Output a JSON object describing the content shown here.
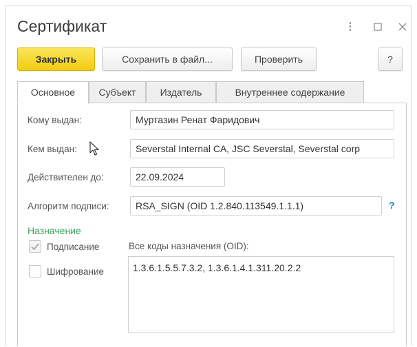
{
  "window": {
    "title": "Сертификат",
    "controls": {
      "more_icon": "⋮",
      "maximize_icon": "☐",
      "close_icon": "✕"
    }
  },
  "toolbar": {
    "close_label": "Закрыть",
    "save_label": "Сохранить в файл...",
    "check_label": "Проверить",
    "help_label": "?"
  },
  "tabs": [
    {
      "label": "Основное",
      "active": true
    },
    {
      "label": "Субъект",
      "active": false
    },
    {
      "label": "Издатель",
      "active": false
    },
    {
      "label": "Внутреннее содержание",
      "active": false
    }
  ],
  "form": {
    "issued_to": {
      "label": "Кому выдан:",
      "value": "Муртазин Ренат Фаридович"
    },
    "issued_by": {
      "label": "Кем выдан:",
      "value": "Severstal Internal CA, JSC Severstal, Severstal corp"
    },
    "valid_until": {
      "label": "Действителен до:",
      "value": "22.09.2024"
    },
    "algorithm": {
      "label": "Алгоритм подписи:",
      "value": "RSA_SIGN (OID 1.2.840.113549.1.1.1)",
      "help": "?"
    },
    "purpose": {
      "section_label": "Назначение",
      "signing": {
        "label": "Подписание",
        "checked": true
      },
      "encryption": {
        "label": "Шифрование",
        "checked": false
      },
      "oid_label": "Все коды назначения (OID):",
      "oid_value": "1.3.6.1.5.5.7.3.2, 1.3.6.1.4.1.311.20.2.2"
    }
  },
  "colors": {
    "accent_yellow": "#f2cd10",
    "section_green": "#3aa657",
    "help_blue": "#1f86c9"
  }
}
